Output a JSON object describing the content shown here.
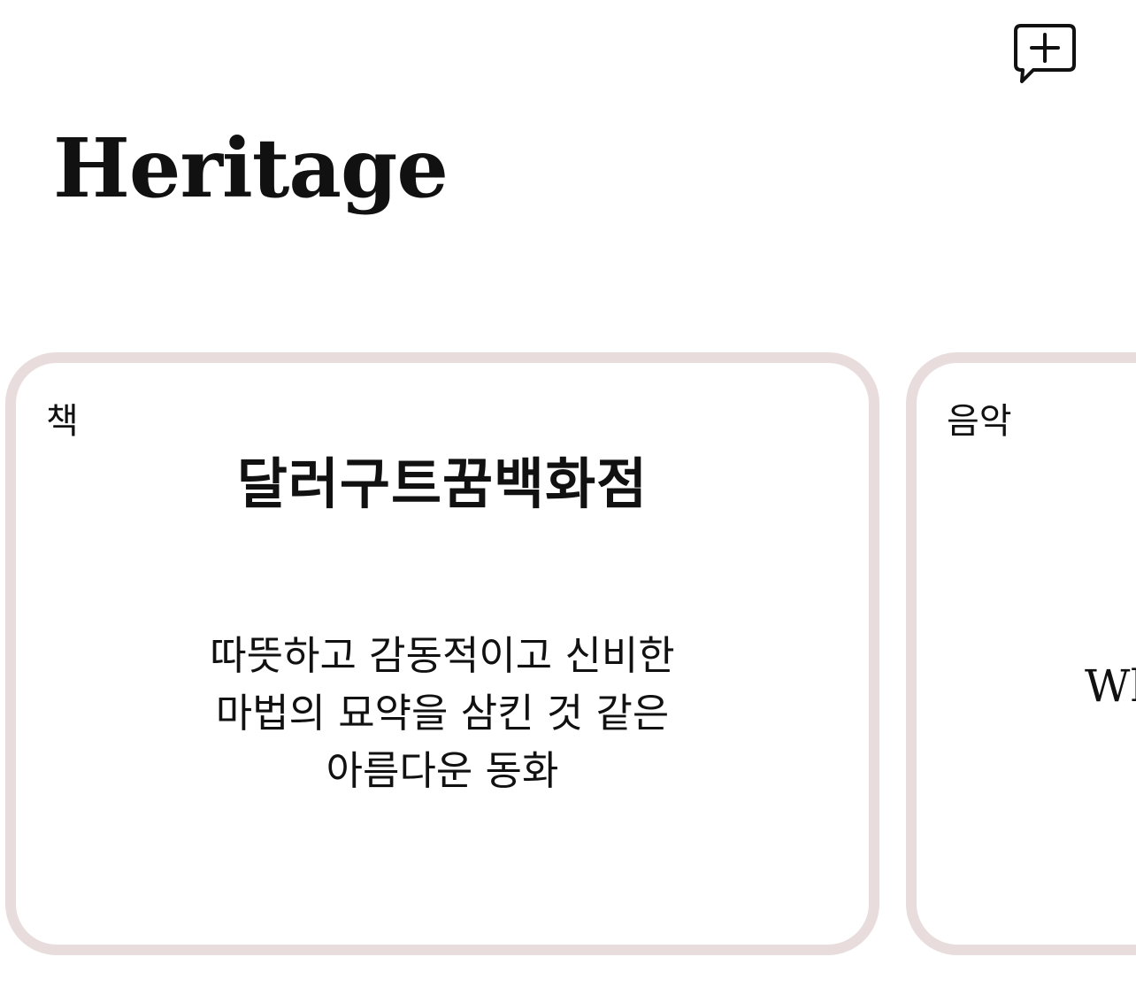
{
  "header": {
    "new_comment_icon": "chat-bubble-plus-icon",
    "title": "Heritage"
  },
  "cards": [
    {
      "category": "책",
      "title": "달러구트꿈백화점",
      "description_lines": [
        "따뜻하고 감동적이고 신비한",
        "마법의 묘약을 삼킨 것 같은",
        "아름다운 동화"
      ]
    },
    {
      "category": "음악",
      "title": "",
      "description_lines": [
        "Wh"
      ]
    }
  ],
  "colors": {
    "card_border": "#e8dcdc",
    "text": "#111111",
    "background": "#ffffff"
  }
}
